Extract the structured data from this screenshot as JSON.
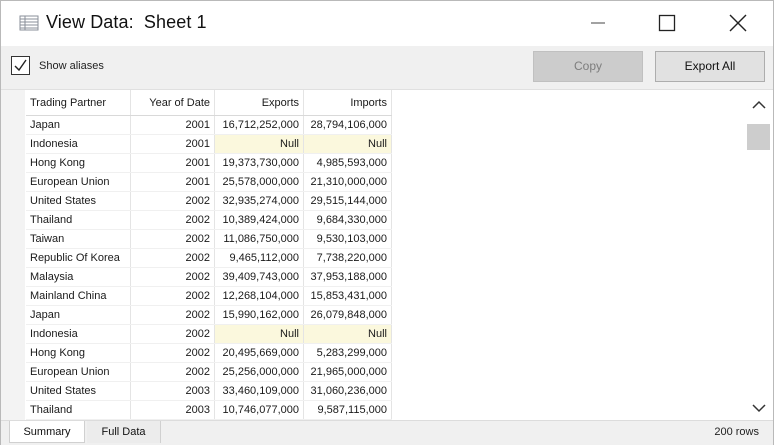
{
  "window": {
    "title": "View Data:  Sheet 1"
  },
  "icons": {
    "title": "table-icon",
    "minimize": "minimize-icon",
    "maximize": "maximize-icon",
    "close": "close-icon",
    "checkbox": "checkmark-icon",
    "scroll_up": "chevron-up-icon",
    "scroll_down": "chevron-down-icon"
  },
  "toolbar": {
    "show_aliases_label": "Show aliases",
    "show_aliases_checked": true,
    "copy_label": "Copy",
    "export_label": "Export All"
  },
  "table": {
    "columns": [
      "Trading Partner",
      "Year of Date",
      "Exports",
      "Imports"
    ],
    "rows": [
      [
        "Japan",
        "2001",
        "16,712,252,000",
        "28,794,106,000"
      ],
      [
        "Indonesia",
        "2001",
        "Null",
        "Null"
      ],
      [
        "Hong Kong",
        "2001",
        "19,373,730,000",
        "4,985,593,000"
      ],
      [
        "European Union",
        "2001",
        "25,578,000,000",
        "21,310,000,000"
      ],
      [
        "United States",
        "2002",
        "32,935,274,000",
        "29,515,144,000"
      ],
      [
        "Thailand",
        "2002",
        "10,389,424,000",
        "9,684,330,000"
      ],
      [
        "Taiwan",
        "2002",
        "11,086,750,000",
        "9,530,103,000"
      ],
      [
        "Republic Of Korea",
        "2002",
        "9,465,112,000",
        "7,738,220,000"
      ],
      [
        "Malaysia",
        "2002",
        "39,409,743,000",
        "37,953,188,000"
      ],
      [
        "Mainland China",
        "2002",
        "12,268,104,000",
        "15,853,431,000"
      ],
      [
        "Japan",
        "2002",
        "15,990,162,000",
        "26,079,848,000"
      ],
      [
        "Indonesia",
        "2002",
        "Null",
        "Null"
      ],
      [
        "Hong Kong",
        "2002",
        "20,495,669,000",
        "5,283,299,000"
      ],
      [
        "European Union",
        "2002",
        "25,256,000,000",
        "21,965,000,000"
      ],
      [
        "United States",
        "2003",
        "33,460,109,000",
        "31,060,236,000"
      ],
      [
        "Thailand",
        "2003",
        "10,746,077,000",
        "9,587,115,000"
      ]
    ]
  },
  "status": {
    "tabs": [
      "Summary",
      "Full Data"
    ],
    "active_tab": "Summary",
    "row_count": "200 rows"
  },
  "colors": {
    "null_cell": "#fbf8dd",
    "toolbar_bg": "#f0f0f0",
    "disabled_button": "#cccccc"
  }
}
